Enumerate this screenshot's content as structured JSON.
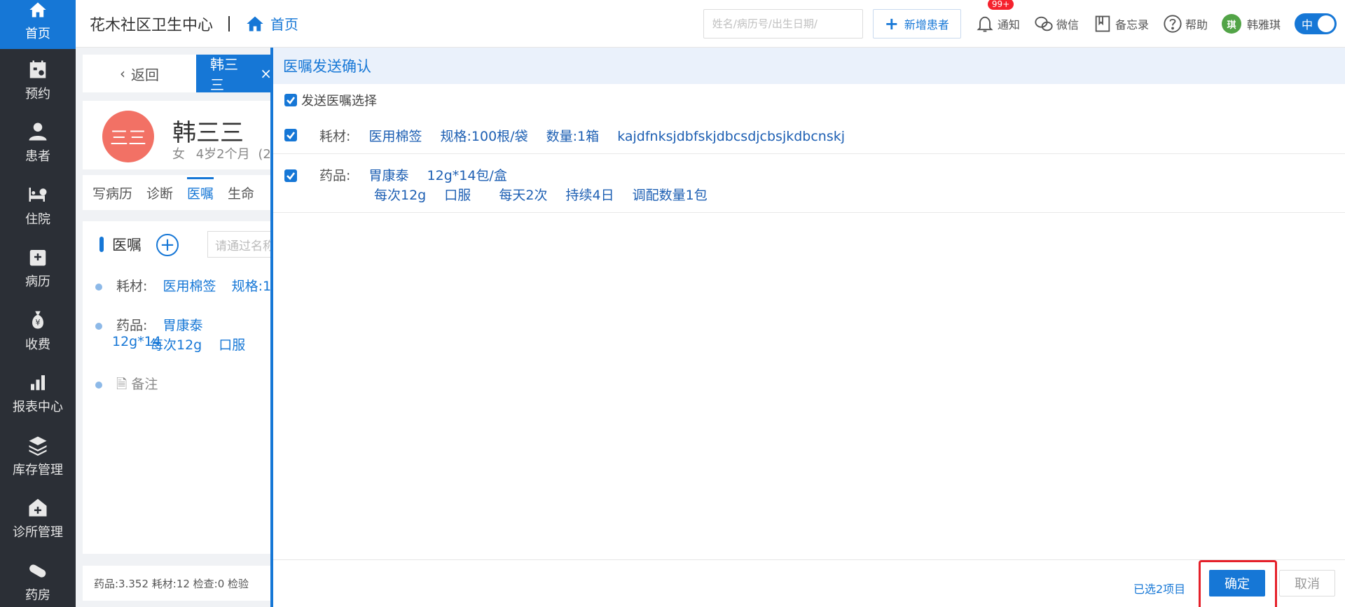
{
  "sidebar": {
    "items": [
      {
        "label": "首页",
        "icon": "home-icon"
      },
      {
        "label": "预约",
        "icon": "calendar-icon"
      },
      {
        "label": "患者",
        "icon": "user-icon"
      },
      {
        "label": "住院",
        "icon": "bed-icon"
      },
      {
        "label": "病历",
        "icon": "medical-record-icon"
      },
      {
        "label": "收费",
        "icon": "money-bag-icon"
      },
      {
        "label": "报表中心",
        "icon": "bar-chart-icon"
      },
      {
        "label": "库存管理",
        "icon": "layers-icon"
      },
      {
        "label": "诊所管理",
        "icon": "clinic-icon"
      },
      {
        "label": "药房",
        "icon": "pill-icon"
      }
    ]
  },
  "header": {
    "clinic_name": "花木社区卫生中心",
    "breadcrumb": "首页",
    "search_placeholder": "姓名/病历号/出生日期/",
    "new_patient": "新增患者",
    "notify": "通知",
    "notify_badge": "99+",
    "wechat": "微信",
    "memo": "备忘录",
    "help": "帮助",
    "user_initial": "琪",
    "user_name": "韩雅琪",
    "lang_toggle": "中"
  },
  "tabs": {
    "back": "返回",
    "patient_tab": "韩三三",
    "close": "×"
  },
  "patient": {
    "avatar_text": "三三",
    "name": "韩三三",
    "gender": "女",
    "age": "4岁2个月",
    "extra": "(2"
  },
  "inner_tabs": [
    "写病历",
    "诊断",
    "医嘱",
    "生命"
  ],
  "orders": {
    "title": "医嘱",
    "filter_placeholder": "请通过名称",
    "row1": {
      "type": "耗材:",
      "name": "医用棉签",
      "spec": "规格:1"
    },
    "row2": {
      "type": "药品:",
      "name": "胃康泰",
      "spec": "12g*14",
      "dose": "每次12g",
      "route": "口服"
    },
    "note": "备注"
  },
  "footer_left": "药品:3.352   耗材:12   检查:0   检验",
  "drawer": {
    "title": "医嘱发送确认",
    "select_all": "发送医嘱选择",
    "item1": {
      "type": "耗材:",
      "name": "医用棉签",
      "spec": "规格:100根/袋",
      "qty": "数量:1箱",
      "note": "kajdfnksjdbfskjdbcsdjcbsjkdbcnskj"
    },
    "item2": {
      "type": "药品:",
      "name": "胃康泰",
      "spec": "12g*14包/盒",
      "dose": "每次12g",
      "route": "口服",
      "freq": "每天2次",
      "duration": "持续4日",
      "dispense": "调配数量1包"
    },
    "selected_count": "已选2项目",
    "confirm": "确定",
    "cancel": "取消"
  },
  "colors": {
    "primary": "#1677d6",
    "sidebar_bg": "#2b2f36",
    "highlight": "#e5202a"
  }
}
